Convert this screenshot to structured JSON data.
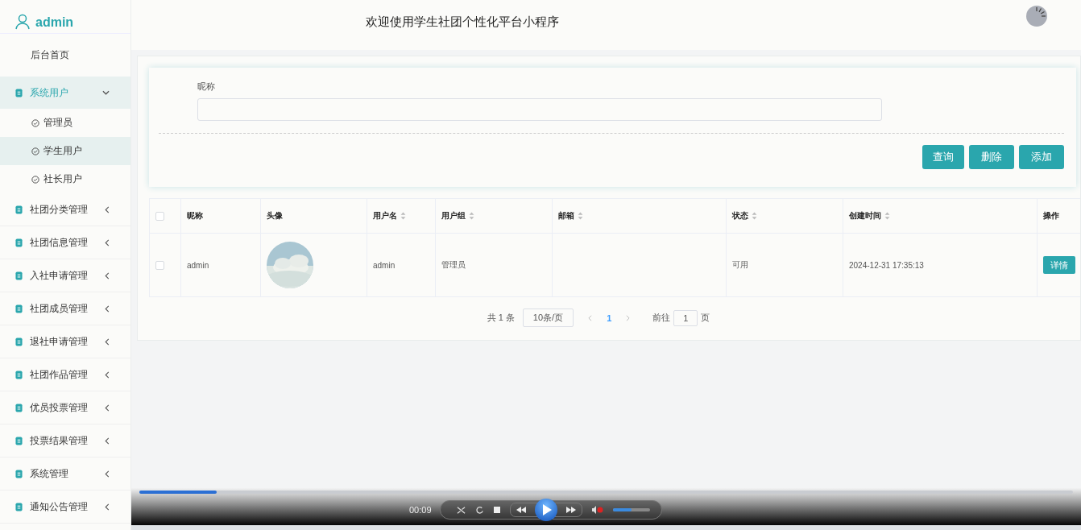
{
  "header": {
    "user": "admin",
    "title": "欢迎使用学生社团个性化平台小程序"
  },
  "sidebar": {
    "items": [
      {
        "label": "后台首页",
        "kind": "link"
      },
      {
        "label": "系统用户",
        "kind": "group",
        "expanded": true,
        "children": [
          {
            "label": "管理员",
            "selected": false
          },
          {
            "label": "学生用户",
            "selected": true
          },
          {
            "label": "社长用户",
            "selected": false
          }
        ]
      },
      {
        "label": "社团分类管理",
        "kind": "group",
        "expanded": false
      },
      {
        "label": "社团信息管理",
        "kind": "group",
        "expanded": false
      },
      {
        "label": "入社申请管理",
        "kind": "group",
        "expanded": false
      },
      {
        "label": "社团成员管理",
        "kind": "group",
        "expanded": false
      },
      {
        "label": "退社申请管理",
        "kind": "group",
        "expanded": false
      },
      {
        "label": "社团作品管理",
        "kind": "group",
        "expanded": false
      },
      {
        "label": "优员投票管理",
        "kind": "group",
        "expanded": false
      },
      {
        "label": "投票结果管理",
        "kind": "group",
        "expanded": false
      },
      {
        "label": "系统管理",
        "kind": "group",
        "expanded": false
      },
      {
        "label": "通知公告管理",
        "kind": "group",
        "expanded": false
      }
    ]
  },
  "search": {
    "label": "昵称",
    "buttons": [
      "查询",
      "删除",
      "添加"
    ]
  },
  "table": {
    "select_all_checked": false,
    "columns": [
      {
        "label": "昵称",
        "sortable": false
      },
      {
        "label": "头像",
        "sortable": false
      },
      {
        "label": "用户名",
        "sortable": true
      },
      {
        "label": "用户组",
        "sortable": true
      },
      {
        "label": "邮箱",
        "sortable": true
      },
      {
        "label": "状态",
        "sortable": true
      },
      {
        "label": "创建时间",
        "sortable": true
      },
      {
        "label": "操作",
        "sortable": false
      }
    ],
    "rows": [
      {
        "checked": false,
        "nickname": "admin",
        "username": "admin",
        "group": "管理员",
        "status": "可用",
        "created": "2024-12-31 17:35:13",
        "action": "详情"
      }
    ]
  },
  "pagination": {
    "total": "共 1 条",
    "page_size": "10条/页",
    "pages": [
      {
        "label": "1",
        "selected": true
      }
    ],
    "goto_label": "前往",
    "goto_value": "1",
    "goto_suffix": "页"
  },
  "player": {
    "time": "00:09",
    "seek": {
      "level": 0.083
    },
    "volume": {
      "level": 0.5
    }
  }
}
